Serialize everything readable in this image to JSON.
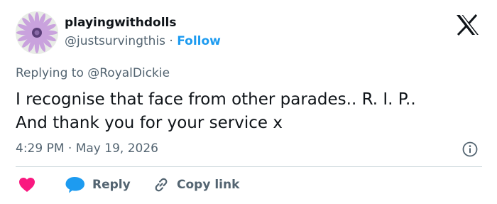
{
  "tweet": {
    "display_name": "playingwithdolls",
    "handle": "@justsurvingthis",
    "separator": "·",
    "follow_label": "Follow",
    "replying_prefix": "Replying to",
    "replying_to": "@RoyalDickie",
    "text_line1": "I recognise that face from other parades.. R. I. P..",
    "text_line2": "And thank you for your service x",
    "time": "4:29 PM",
    "date": "May 19, 2026"
  },
  "actions": {
    "like_icon": "heart-icon",
    "reply_label": "Reply",
    "reply_icon": "speech-bubble-icon",
    "copy_label": "Copy link",
    "copy_icon": "link-icon"
  },
  "icons": {
    "brand": "x-logo-icon",
    "info": "info-icon",
    "avatar": "daisy-flower-image"
  },
  "colors": {
    "accent": "#1d9bf0",
    "like": "#f91880",
    "text": "#0f1419",
    "muted": "#536471",
    "divider": "#cfd9de"
  }
}
